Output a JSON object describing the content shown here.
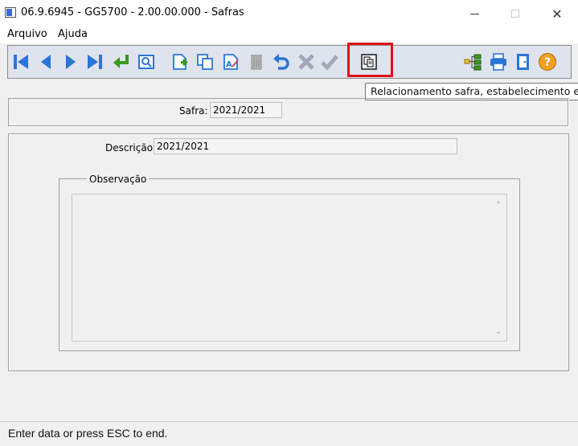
{
  "window": {
    "title": "06.9.6945 - GG5700 - 2.00.00.000 - Safras",
    "close_glyph": "✕"
  },
  "menu": {
    "items": [
      {
        "label": "Arquivo"
      },
      {
        "label": "Ajuda"
      }
    ]
  },
  "toolbar": {
    "icons": [
      "first-record-icon",
      "previous-record-icon",
      "next-record-icon",
      "last-record-icon",
      "goto-icon",
      "search-icon",
      "new-record-icon",
      "copy-record-icon",
      "edit-record-icon",
      "delete-record-icon",
      "undo-icon",
      "cancel-icon",
      "confirm-icon",
      "relationship-icon",
      "hierarchy-icon",
      "print-icon",
      "exit-icon",
      "help-icon"
    ],
    "highlighted": "relationship-icon",
    "help_glyph": "?",
    "colors": {
      "nav_blue": "#2a75d8",
      "goto_green": "#3a9a1e",
      "help_orange": "#f0a020",
      "highlight_red": "#e0101a"
    }
  },
  "tooltip": {
    "text": "Relacionamento safra, estabelecimento e ite"
  },
  "form": {
    "safra_label": "Safra:",
    "safra_value": "2021/2021",
    "descricao_label": "Descrição:",
    "descricao_value": "2021/2021",
    "observacao_title": "Observação",
    "observacao_value": "",
    "scroll_up_glyph": "⌃",
    "scroll_down_glyph": "⌄"
  },
  "status": {
    "text": "Enter data or press ESC to end."
  }
}
